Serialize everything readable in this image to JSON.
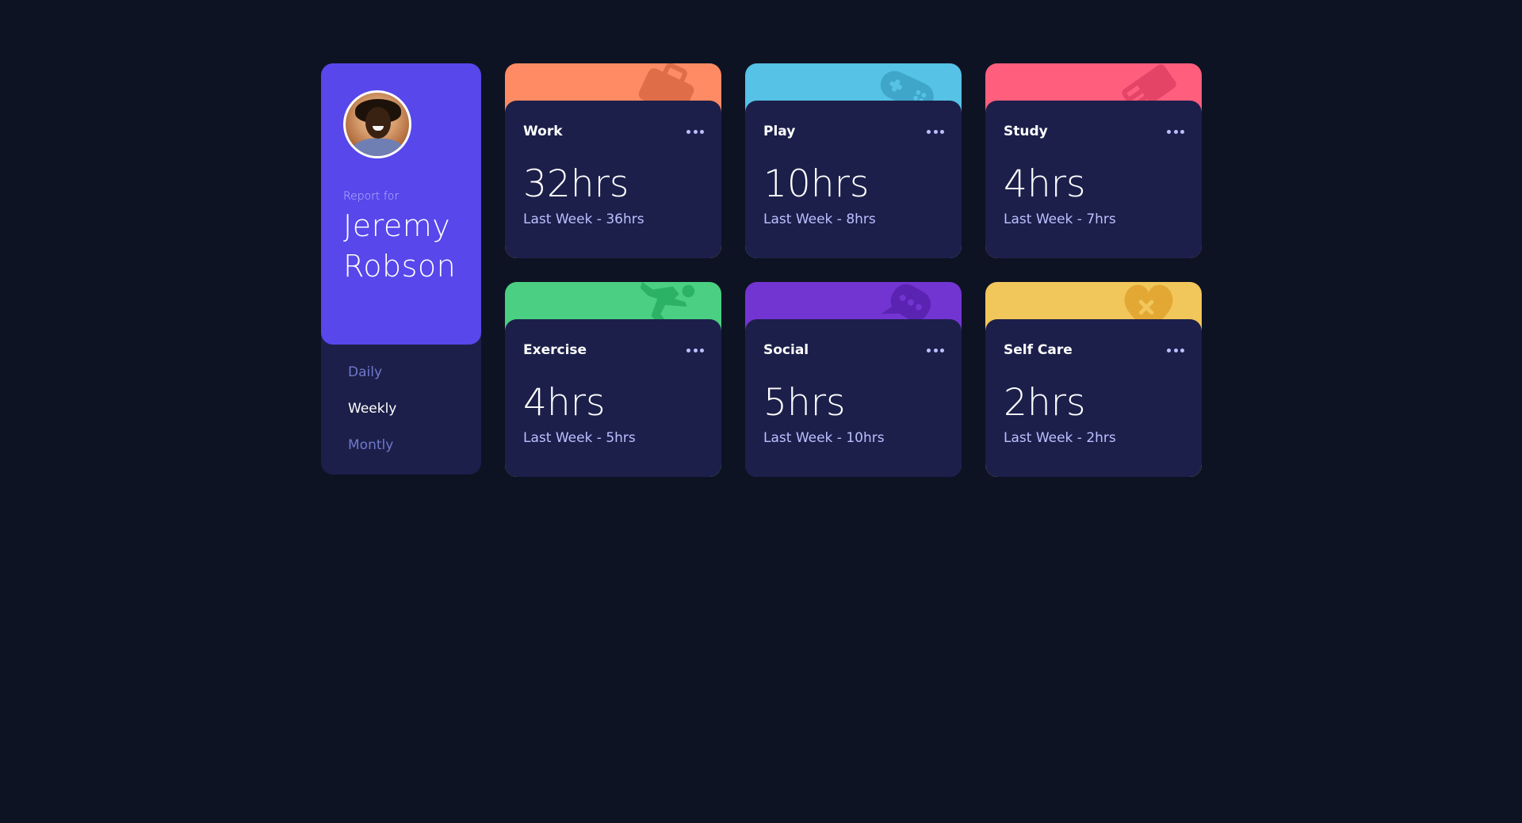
{
  "profile": {
    "report_for": "Report for",
    "first_name": "Jeremy",
    "last_name": "Robson",
    "accent_color": "#5847eb"
  },
  "periods": [
    {
      "label": "Daily",
      "active": false
    },
    {
      "label": "Weekly",
      "active": true
    },
    {
      "label": "Montly",
      "active": false
    }
  ],
  "cards": [
    {
      "title": "Work",
      "current": "32hrs",
      "previous": "Last Week - 36hrs",
      "color": "#ff8b64",
      "icon": "briefcase-icon"
    },
    {
      "title": "Play",
      "current": "10hrs",
      "previous": "Last Week - 8hrs",
      "color": "#55c2e6",
      "icon": "gamepad-icon"
    },
    {
      "title": "Study",
      "current": "4hrs",
      "previous": "Last Week - 7hrs",
      "color": "#ff5e7d",
      "icon": "book-icon"
    },
    {
      "title": "Exercise",
      "current": "4hrs",
      "previous": "Last Week - 5hrs",
      "color": "#4bcf82",
      "icon": "running-icon"
    },
    {
      "title": "Social",
      "current": "5hrs",
      "previous": "Last Week - 10hrs",
      "color": "#7335d2",
      "icon": "chat-icon"
    },
    {
      "title": "Self Care",
      "current": "2hrs",
      "previous": "Last Week - 2hrs",
      "color": "#f1c75b",
      "icon": "heart-icon"
    }
  ]
}
